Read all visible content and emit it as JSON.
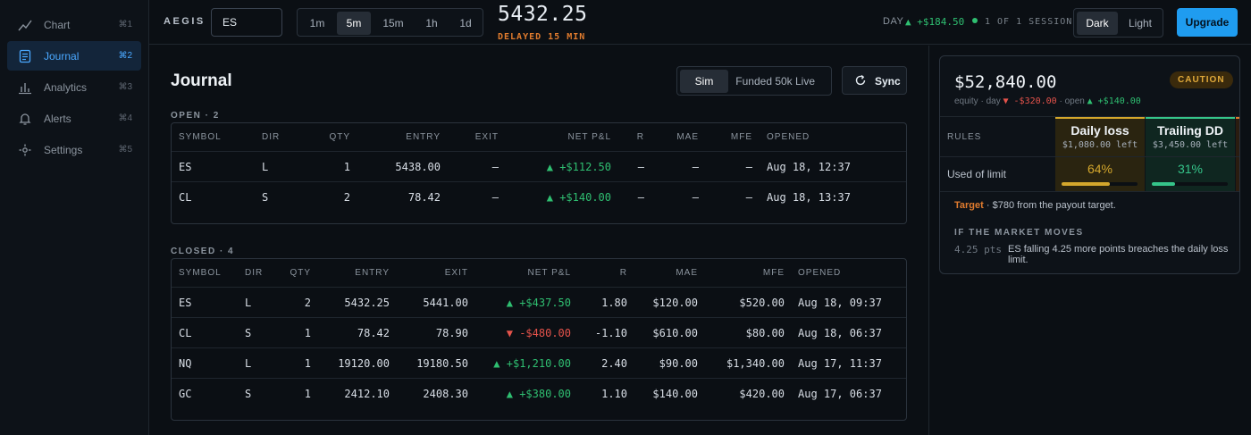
{
  "sidebar": {
    "items": [
      {
        "label": "Chart",
        "shortcut": "⌘1",
        "icon": "line-chart-icon"
      },
      {
        "label": "Journal",
        "shortcut": "⌘2",
        "icon": "journal-icon",
        "active": true
      },
      {
        "label": "Analytics",
        "shortcut": "⌘3",
        "icon": "bar-chart-icon"
      },
      {
        "label": "Alerts",
        "shortcut": "⌘4",
        "icon": "bell-icon"
      },
      {
        "label": "Settings",
        "shortcut": "⌘5",
        "icon": "gear-icon"
      }
    ]
  },
  "topbar": {
    "brand": "AEGIS",
    "symbol": "ES",
    "timeframes": [
      "1m",
      "5m",
      "15m",
      "1h",
      "1d"
    ],
    "active_timeframe": "5m",
    "price": "5432.25",
    "delayed": "DELAYED 15 MIN",
    "day_label": "DAY",
    "day_value": "▲ +$184.50",
    "session": "1 OF 1 SESSION",
    "theme_options": [
      "Dark",
      "Light"
    ],
    "active_theme": "Dark",
    "upgrade": "Upgrade"
  },
  "colors": {
    "accent": "#1f9cf0",
    "positive": "#2fbf71",
    "negative": "#e5534b",
    "warning": "#e07b2e",
    "caution": "#d4a72c"
  },
  "main": {
    "title": "Journal",
    "modes": [
      "Sim",
      "Funded 50k",
      "Live"
    ],
    "active_mode": "Sim",
    "sync": "Sync",
    "open": {
      "label": "OPEN · 2",
      "headers": [
        "SYMBOL",
        "DIR",
        "QTY",
        "ENTRY",
        "EXIT",
        "NET P&L",
        "R",
        "MAE",
        "MFE",
        "OPENED"
      ],
      "rows": [
        {
          "symbol": "ES",
          "dir": "L",
          "qty": "1",
          "entry": "5438.00",
          "exit": "—",
          "pnl": "▲ +$112.50",
          "r": "—",
          "mae": "—",
          "mfe": "—",
          "opened": "Aug 18, 12:37",
          "sign": "pos"
        },
        {
          "symbol": "CL",
          "dir": "S",
          "qty": "2",
          "entry": "78.42",
          "exit": "—",
          "pnl": "▲ +$140.00",
          "r": "—",
          "mae": "—",
          "mfe": "—",
          "opened": "Aug 18, 13:37",
          "sign": "pos"
        }
      ]
    },
    "closed": {
      "label": "CLOSED · 4",
      "headers": [
        "SYMBOL",
        "DIR",
        "QTY",
        "ENTRY",
        "EXIT",
        "NET P&L",
        "R",
        "MAE",
        "MFE",
        "OPENED"
      ],
      "rows": [
        {
          "symbol": "ES",
          "dir": "L",
          "qty": "2",
          "entry": "5432.25",
          "exit": "5441.00",
          "pnl": "▲ +$437.50",
          "r": "1.80",
          "mae": "$120.00",
          "mfe": "$520.00",
          "opened": "Aug 18, 09:37",
          "sign": "pos"
        },
        {
          "symbol": "CL",
          "dir": "S",
          "qty": "1",
          "entry": "78.42",
          "exit": "78.90",
          "pnl": "▼ -$480.00",
          "r": "-1.10",
          "mae": "$610.00",
          "mfe": "$80.00",
          "opened": "Aug 18, 06:37",
          "sign": "neg"
        },
        {
          "symbol": "NQ",
          "dir": "L",
          "qty": "1",
          "entry": "19120.00",
          "exit": "19180.50",
          "pnl": "▲ +$1,210.00",
          "r": "2.40",
          "mae": "$90.00",
          "mfe": "$1,340.00",
          "opened": "Aug 17, 11:37",
          "sign": "pos"
        },
        {
          "symbol": "GC",
          "dir": "S",
          "qty": "1",
          "entry": "2412.10",
          "exit": "2408.30",
          "pnl": "▲ +$380.00",
          "r": "1.10",
          "mae": "$140.00",
          "mfe": "$420.00",
          "opened": "Aug 17, 06:37",
          "sign": "pos"
        }
      ]
    }
  },
  "panel": {
    "equity": "$52,840.00",
    "equity_sub": {
      "prefix": "equity · day",
      "day": "▼ -$320.00",
      "open_prefix": "· open",
      "open": "▲ +$140.00"
    },
    "badge": "CAUTION",
    "rules_label": "RULES",
    "used_label": "Used of limit",
    "rules": [
      {
        "title": "Daily loss",
        "left": "$1,080.00 left",
        "pct": "64%",
        "fill": 0.64,
        "color": "#d4a72c"
      },
      {
        "title": "Trailing DD",
        "left": "$3,450.00 left",
        "pct": "31%",
        "fill": 0.31,
        "color": "#35c58a"
      }
    ],
    "target_word": "Target",
    "target_text": "· $780 from the payout target.",
    "if_moves": "IF THE MARKET MOVES",
    "pts": "4.25 pts",
    "breach": "ES falling 4.25 more points breaches the daily loss limit."
  }
}
